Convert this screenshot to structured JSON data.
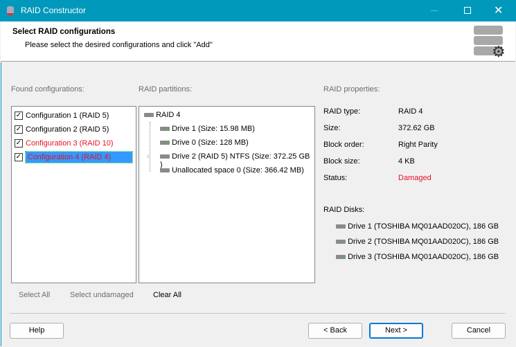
{
  "window": {
    "title": "RAID Constructor"
  },
  "header": {
    "title": "Select RAID configurations",
    "subtitle": "Please select the desired configurations and click \"Add\""
  },
  "found": {
    "label": "Found configurations:",
    "items": [
      {
        "label": "Configuration 1 (RAID 5)",
        "checked": true,
        "damaged": false
      },
      {
        "label": "Configuration 2 (RAID 5)",
        "checked": true,
        "damaged": false
      },
      {
        "label": "Configuration 3 (RAID 10)",
        "checked": true,
        "damaged": true
      },
      {
        "label": "Configuration 4 (RAID 4)",
        "checked": true,
        "damaged": true,
        "selected": true
      }
    ]
  },
  "partitions": {
    "label": "RAID partitions:",
    "root": "RAID 4",
    "children": [
      "Drive 1 (Size: 15.98 MB)",
      "Drive 0 (Size: 128 MB)",
      "Drive 2 (RAID 5) NTFS (Size: 372.25 GB )",
      "Unallocated space 0 (Size: 366.42 MB)"
    ]
  },
  "properties": {
    "label": "RAID properties:",
    "rows": [
      {
        "key": "RAID type:",
        "value": "RAID 4"
      },
      {
        "key": "Size:",
        "value": "372.62 GB"
      },
      {
        "key": "Block order:",
        "value": "Right Parity"
      },
      {
        "key": "Block size:",
        "value": "4 KB"
      },
      {
        "key": "Status:",
        "value": "Damaged"
      }
    ],
    "disks_label": "RAID Disks:",
    "disks": [
      "Drive 1 (TOSHIBA MQ01AAD020C), 186 GB",
      "Drive 2 (TOSHIBA MQ01AAD020C), 186 GB",
      "Drive 3 (TOSHIBA MQ01AAD020C), 186 GB"
    ]
  },
  "links": {
    "select_all": "Select All",
    "select_undamaged": "Select undamaged",
    "clear_all": "Clear All"
  },
  "buttons": {
    "help": "Help",
    "back": "< Back",
    "next": "Next >",
    "cancel": "Cancel"
  },
  "colors": {
    "titlebar": "#0099bb",
    "damaged": "#e81123",
    "selection": "#3399ff"
  }
}
